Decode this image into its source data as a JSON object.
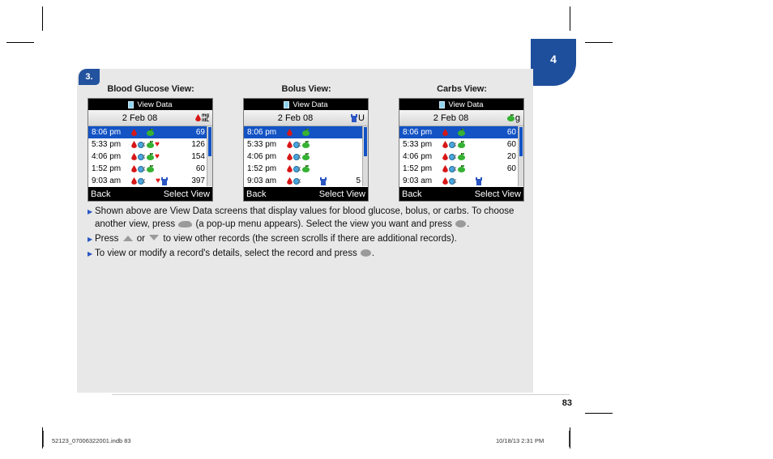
{
  "page": {
    "chapter_tab": "4",
    "step_number": "3.",
    "page_number": "83",
    "footer_left": "52123_07006322001.indb   83",
    "footer_right": "10/18/13   2:31 PM"
  },
  "screens": [
    {
      "caption": "Blood Glucose View:",
      "title": "View Data",
      "title_icon": "document-icon",
      "date": "2 Feb 08",
      "unit_icon": "blood-drop-icon",
      "unit_label_top": "mg",
      "unit_label_bottom": "/dL",
      "unit_label": "mg/dL",
      "rows": [
        {
          "time": "8:06 pm",
          "icons": [
            "blood-drop-icon",
            "",
            "apple-icon"
          ],
          "value": "69",
          "selected": true
        },
        {
          "time": "5:33 pm",
          "icons": [
            "blood-drop-icon",
            "bolus-meal-icon",
            "apple-icon",
            "heart-icon"
          ],
          "value": "126",
          "selected": false
        },
        {
          "time": "4:06 pm",
          "icons": [
            "blood-drop-icon",
            "bolus-meal-icon",
            "apple-icon",
            "heart-icon"
          ],
          "value": "154",
          "selected": false
        },
        {
          "time": "1:52 pm",
          "icons": [
            "blood-drop-icon",
            "bolus-meal-icon",
            "apple-icon"
          ],
          "value": "60",
          "selected": false
        },
        {
          "time": "9:03 am",
          "icons": [
            "blood-drop-icon",
            "bolus-meal-icon",
            "",
            "heart-icon",
            "syringe-icon"
          ],
          "value": "397",
          "selected": false
        }
      ],
      "soft_left": "Back",
      "soft_right": "Select View"
    },
    {
      "caption": "Bolus View:",
      "title": "View Data",
      "title_icon": "document-icon",
      "date": "2 Feb 08",
      "unit_icon": "syringe-icon",
      "unit_label_top": "",
      "unit_label_bottom": "",
      "unit_label": "U",
      "rows": [
        {
          "time": "8:06 pm",
          "icons": [
            "blood-drop-icon",
            "",
            "apple-icon"
          ],
          "value": "",
          "selected": true
        },
        {
          "time": "5:33 pm",
          "icons": [
            "blood-drop-icon",
            "bolus-meal-icon",
            "apple-icon"
          ],
          "value": "",
          "selected": false
        },
        {
          "time": "4:06 pm",
          "icons": [
            "blood-drop-icon",
            "bolus-meal-icon",
            "apple-icon"
          ],
          "value": "",
          "selected": false
        },
        {
          "time": "1:52 pm",
          "icons": [
            "blood-drop-icon",
            "bolus-meal-icon",
            "apple-icon"
          ],
          "value": "",
          "selected": false
        },
        {
          "time": "9:03 am",
          "icons": [
            "blood-drop-icon",
            "bolus-meal-icon",
            "",
            "",
            "syringe-icon"
          ],
          "value": "5",
          "selected": false
        }
      ],
      "soft_left": "Back",
      "soft_right": "Select View"
    },
    {
      "caption": "Carbs View:",
      "title": "View Data",
      "title_icon": "document-icon",
      "date": "2 Feb 08",
      "unit_icon": "apple-icon",
      "unit_label_top": "",
      "unit_label_bottom": "",
      "unit_label": "g",
      "rows": [
        {
          "time": "8:06 pm",
          "icons": [
            "blood-drop-icon",
            "",
            "apple-icon"
          ],
          "value": "60",
          "selected": true
        },
        {
          "time": "5:33 pm",
          "icons": [
            "blood-drop-icon",
            "bolus-meal-icon",
            "apple-icon"
          ],
          "value": "60",
          "selected": false
        },
        {
          "time": "4:06 pm",
          "icons": [
            "blood-drop-icon",
            "bolus-meal-icon",
            "apple-icon"
          ],
          "value": "20",
          "selected": false
        },
        {
          "time": "1:52 pm",
          "icons": [
            "blood-drop-icon",
            "bolus-meal-icon",
            "apple-icon"
          ],
          "value": "60",
          "selected": false
        },
        {
          "time": "9:03 am",
          "icons": [
            "blood-drop-icon",
            "bolus-meal-icon",
            "",
            "",
            "syringe-icon"
          ],
          "value": "",
          "selected": false
        }
      ],
      "soft_left": "Back",
      "soft_right": "Select View"
    }
  ],
  "bullets": [
    {
      "parts": [
        {
          "type": "text",
          "value": "Shown above are View Data screens that display values for blood glucose, bolus, or carbs. To choose another view, press "
        },
        {
          "type": "icon",
          "value": "menu-button-icon"
        },
        {
          "type": "text",
          "value": " (a pop-up menu appears). Select the view you want and press "
        },
        {
          "type": "icon",
          "value": "ok-button-icon"
        },
        {
          "type": "text",
          "value": "."
        }
      ]
    },
    {
      "parts": [
        {
          "type": "text",
          "value": "Press "
        },
        {
          "type": "icon",
          "value": "up-arrow-button-icon"
        },
        {
          "type": "text",
          "value": " or "
        },
        {
          "type": "icon",
          "value": "down-arrow-button-icon"
        },
        {
          "type": "text",
          "value": " to view other records (the screen scrolls if there are additional records)."
        }
      ]
    },
    {
      "parts": [
        {
          "type": "text",
          "value": "To view or modify a record's details, select the record and press "
        },
        {
          "type": "icon",
          "value": "ok-button-icon"
        },
        {
          "type": "text",
          "value": "."
        }
      ]
    }
  ],
  "colors": {
    "accent_blue": "#1e4f9c",
    "selection_blue": "#1353c4",
    "panel_gray": "#e8e8e8",
    "blood_red": "#d81717",
    "apple_green": "#35b233"
  }
}
